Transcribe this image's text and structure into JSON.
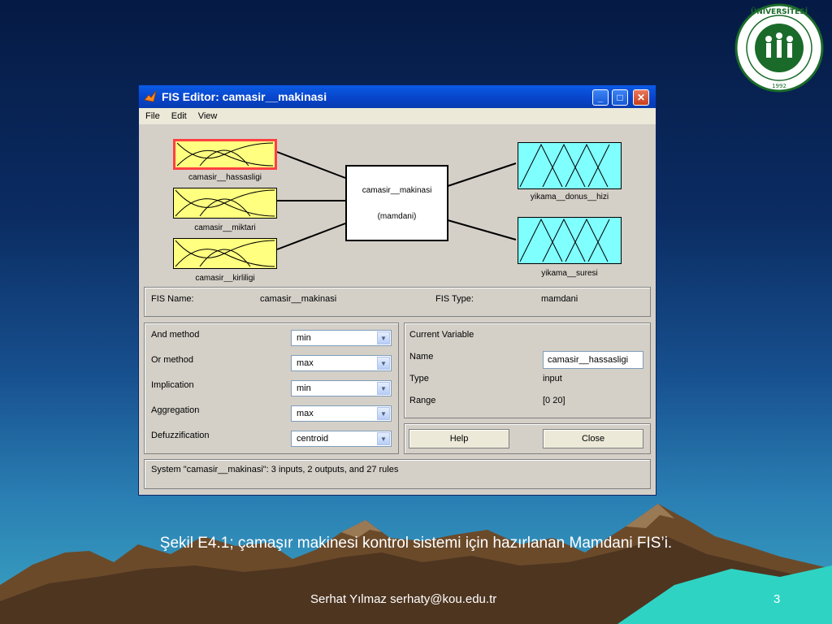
{
  "window": {
    "title": "FIS Editor: camasir__makinasi",
    "menu": [
      "File",
      "Edit",
      "View"
    ]
  },
  "diagram": {
    "inputs": [
      "camasir__hassasligi",
      "camasir__miktari",
      "camasir__kirliligi"
    ],
    "system_name": "camasir__makinasi",
    "system_type": "(mamdani)",
    "outputs": [
      "yikama__donus__hizi",
      "yikama__suresi"
    ]
  },
  "fis": {
    "name_label": "FIS Name:",
    "name_value": "camasir__makinasi",
    "type_label": "FIS Type:",
    "type_value": "mamdani"
  },
  "methods": [
    {
      "label": "And method",
      "value": "min"
    },
    {
      "label": "Or method",
      "value": "max"
    },
    {
      "label": "Implication",
      "value": "min"
    },
    {
      "label": "Aggregation",
      "value": "max"
    },
    {
      "label": "Defuzzification",
      "value": "centroid"
    }
  ],
  "current_variable": {
    "header": "Current Variable",
    "name_label": "Name",
    "name_value": "camasir__hassasligi",
    "type_label": "Type",
    "type_value": "input",
    "range_label": "Range",
    "range_value": "[0 20]"
  },
  "buttons": {
    "help": "Help",
    "close": "Close"
  },
  "status": "System \"camasir__makinasi\": 3 inputs, 2 outputs, and 27 rules",
  "slide": {
    "caption": "Şekil E4.1; çamaşır makinesi kontrol sistemi için hazırlanan Mamdani FIS’i.",
    "author": "Serhat Yılmaz serhaty@kou.edu.tr",
    "page_number": "3",
    "logo_text": "KOCAELİ ÜNİVERSİTESİ",
    "logo_year": "1992"
  },
  "colors": {
    "input_mf": "#ffff80",
    "output_mf": "#80ffff",
    "selected_border": "#ff4040",
    "title_blue": "#0a5ce6"
  },
  "icons": [
    "matlab-icon",
    "minimize-icon",
    "maximize-icon",
    "close-icon",
    "dropdown-arrow-icon"
  ]
}
